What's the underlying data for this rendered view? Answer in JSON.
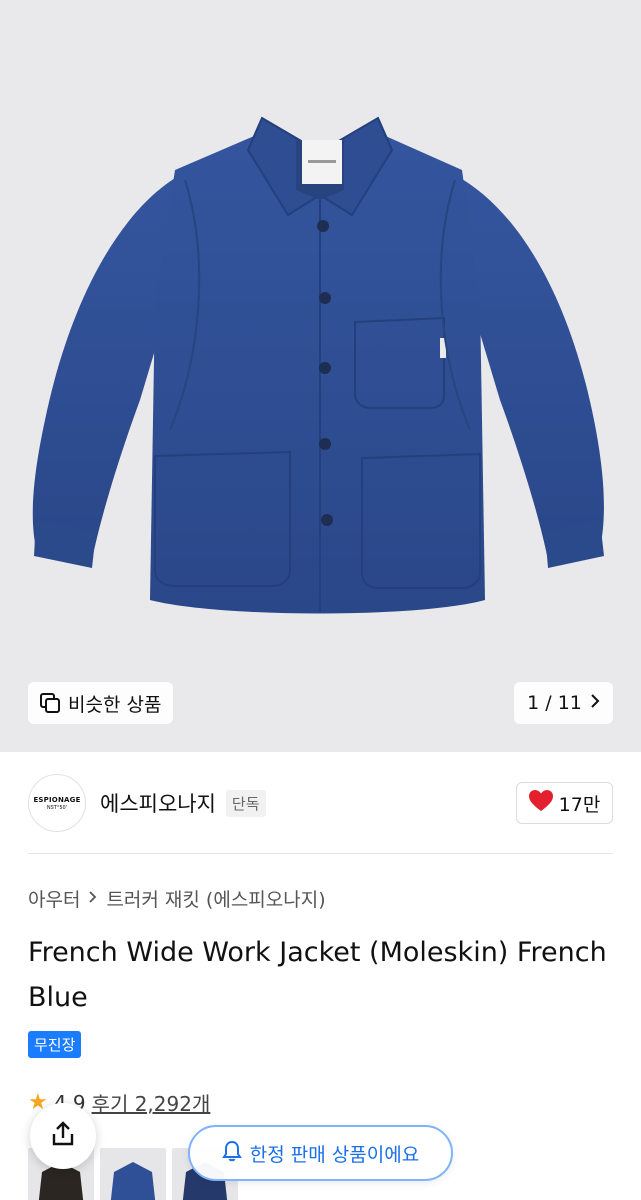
{
  "hero": {
    "image_alt": "French Wide Work Jacket - blue",
    "similar_label": "비슷한 상품",
    "pager_text": "1 / 11"
  },
  "brand": {
    "logo_line1": "ESPIONAGE",
    "logo_line2": "NST°50'",
    "name": "에스피오나지",
    "exclusive_label": "단독",
    "like_count": "17만"
  },
  "breadcrumb": {
    "level1": "아우터",
    "level2": "트러커 재킷 (에스피오나지)"
  },
  "product": {
    "title": "French Wide Work Jacket (Moleskin) French Blue",
    "badge": "무진장",
    "rating": "4.9",
    "reviews": "후기 2,292개"
  },
  "floating": {
    "limited_text": "한정 판매 상품이에요"
  },
  "colors": {
    "accent_blue": "#1b7cff",
    "heart_red": "#e5202e",
    "jacket_blue": "#2f4f97"
  }
}
